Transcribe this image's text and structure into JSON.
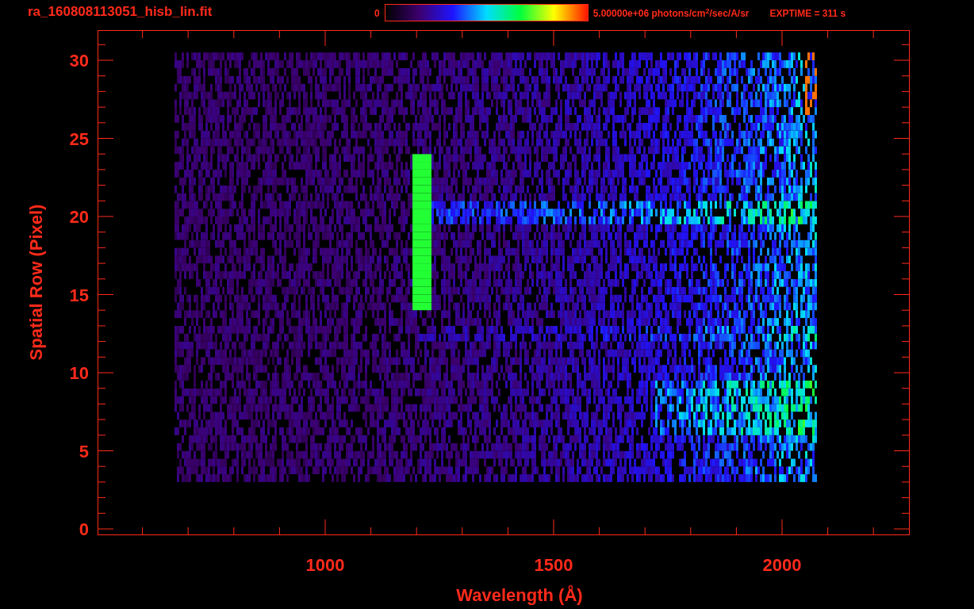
{
  "header": {
    "file_name": "ra_160808113051_hisb_lin.fit",
    "colorbar_min": "0",
    "colorbar_max": "5.00000e+06 photons/cm$^{2}$/sec/A/sr",
    "exposure": "EXPTIME = 311 s"
  },
  "plot": {
    "x_axis": {
      "title": "Wavelength (Å)",
      "ticks": [
        "1000",
        "1500",
        "2000"
      ]
    },
    "y_axis": {
      "title": "Spatial Row (Pixel)",
      "ticks": [
        "30",
        "25",
        "20",
        "15",
        "10",
        "5",
        "0"
      ]
    }
  }
}
